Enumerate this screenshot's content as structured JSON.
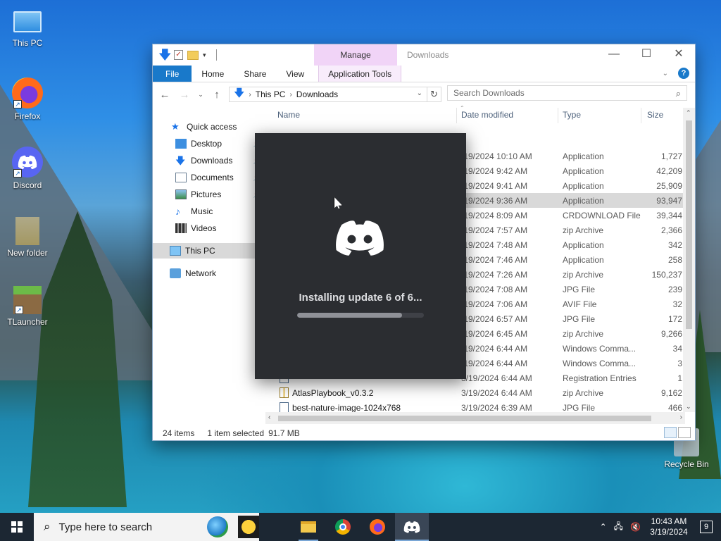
{
  "desktop": {
    "icons": [
      {
        "label": "This PC"
      },
      {
        "label": "Firefox"
      },
      {
        "label": "Discord"
      },
      {
        "label": "New folder"
      },
      {
        "label": "TLauncher"
      },
      {
        "label": "Recycle Bin"
      }
    ]
  },
  "explorer": {
    "title": "Downloads",
    "manage_tab": "Manage",
    "ribbon_tabs": [
      "File",
      "Home",
      "Share",
      "View",
      "Application Tools"
    ],
    "address": {
      "root": "This PC",
      "folder": "Downloads"
    },
    "search_placeholder": "Search Downloads",
    "nav": {
      "quick_access": "Quick access",
      "items": [
        "Desktop",
        "Downloads",
        "Documents",
        "Pictures",
        "Music",
        "Videos"
      ],
      "this_pc": "This PC",
      "network": "Network"
    },
    "columns": {
      "name": "Name",
      "date": "Date modified",
      "type": "Type",
      "size": "Size"
    },
    "files": [
      {
        "name": "",
        "date": "/19/2024 10:10 AM",
        "type": "Application",
        "size": "1,727"
      },
      {
        "name": "",
        "date": "/19/2024 9:42 AM",
        "type": "Application",
        "size": "42,209"
      },
      {
        "name": "",
        "date": "/19/2024 9:41 AM",
        "type": "Application",
        "size": "25,909"
      },
      {
        "name": "",
        "date": "/19/2024 9:36 AM",
        "type": "Application",
        "size": "93,947"
      },
      {
        "name": "",
        "date": "/19/2024 8:09 AM",
        "type": "CRDOWNLOAD File",
        "size": "39,344"
      },
      {
        "name": "",
        "date": "/19/2024 7:57 AM",
        "type": "zip Archive",
        "size": "2,366"
      },
      {
        "name": "",
        "date": "/19/2024 7:48 AM",
        "type": "Application",
        "size": "342"
      },
      {
        "name": "",
        "date": "/19/2024 7:46 AM",
        "type": "Application",
        "size": "258"
      },
      {
        "name": "",
        "date": "/19/2024 7:26 AM",
        "type": "zip Archive",
        "size": "150,237"
      },
      {
        "name": "",
        "date": "/19/2024 7:08 AM",
        "type": "JPG File",
        "size": "239"
      },
      {
        "name": "",
        "date": "/19/2024 7:06 AM",
        "type": "AVIF File",
        "size": "32"
      },
      {
        "name": "",
        "date": "/19/2024 6:57 AM",
        "type": "JPG File",
        "size": "172"
      },
      {
        "name": "",
        "date": "/19/2024 6:45 AM",
        "type": "zip Archive",
        "size": "9,266"
      },
      {
        "name": "",
        "date": "/19/2024 6:44 AM",
        "type": "Windows Comma...",
        "size": "34"
      },
      {
        "name": "",
        "date": "/19/2024 6:44 AM",
        "type": "Windows Comma...",
        "size": "3"
      },
      {
        "name": "",
        "date": "3/19/2024 6:44 AM",
        "type": "Registration Entries",
        "size": "1"
      },
      {
        "name": "AtlasPlaybook_v0.3.2",
        "date": "3/19/2024 6:44 AM",
        "type": "zip Archive",
        "size": "9,162"
      },
      {
        "name": "best-nature-image-1024x768",
        "date": "3/19/2024 6:39 AM",
        "type": "JPG File",
        "size": "466"
      }
    ],
    "status": {
      "count": "24 items",
      "selected": "1 item selected",
      "size": "91.7 MB"
    }
  },
  "updater": {
    "message": "Installing update 6 of 6...",
    "progress": 0.83
  },
  "taskbar": {
    "search_placeholder": "Type here to search",
    "time": "10:43 AM",
    "date": "3/19/2024",
    "notifications": "9"
  },
  "colors": {
    "discord_bg": "#2b2d31",
    "discord_blurple": "#5865f2",
    "file_tab": "#1979ca",
    "manage_tab": "#f1d4f7",
    "taskbar": "#1c2733"
  }
}
